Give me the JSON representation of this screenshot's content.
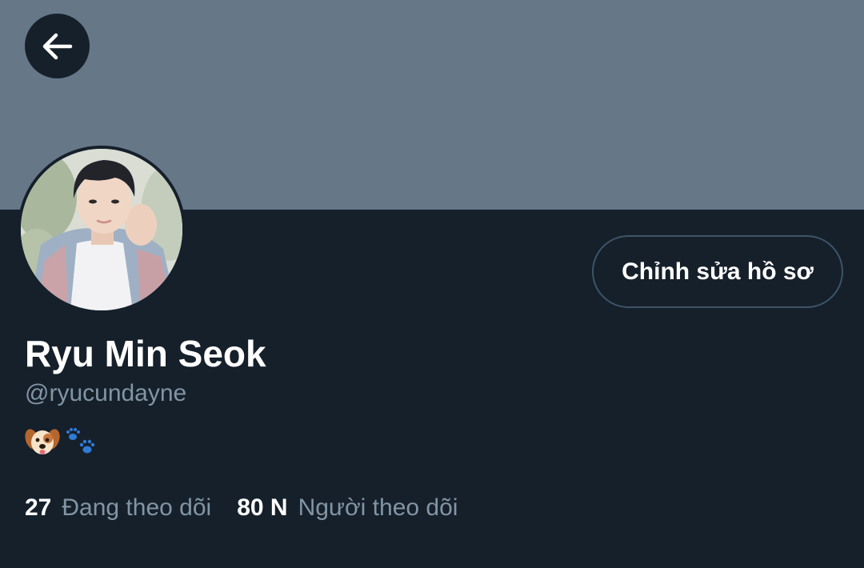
{
  "header": {
    "back_icon": "arrow-left-icon",
    "banner_color": "#667788"
  },
  "profile": {
    "display_name": "Ryu Min Seok",
    "username": "@ryucundayne",
    "bio_emojis": [
      "dog-face-icon",
      "paw-prints-icon"
    ],
    "edit_button_label": "Chỉnh sửa hồ sơ"
  },
  "stats": {
    "following_count": "27",
    "following_label": "Đang theo dõi",
    "followers_count": "80 N",
    "followers_label": "Người theo dõi"
  },
  "colors": {
    "background": "#16202b",
    "secondary_text": "#8295a4",
    "button_border": "#3d5466"
  }
}
